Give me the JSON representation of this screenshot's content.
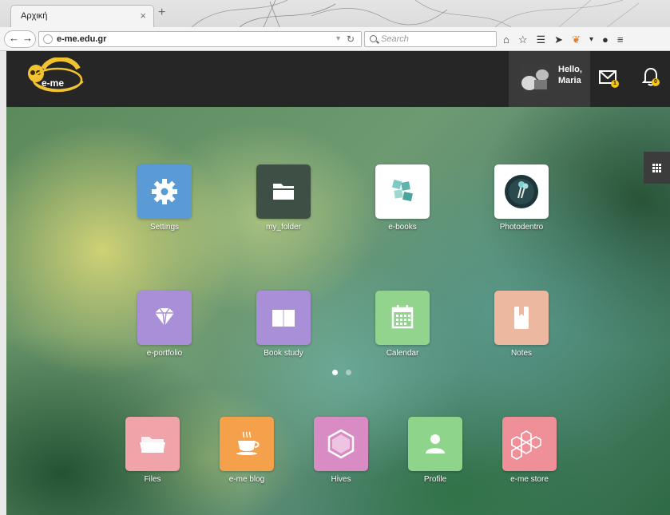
{
  "browser": {
    "tab_title": "Αρχική",
    "tab_close": "×",
    "new_tab": "+",
    "url": "e-me.edu.gr",
    "search_placeholder": "Search"
  },
  "header": {
    "greeting_line1": "Hello,",
    "greeting_line2": "Maria",
    "mail_badge": "1",
    "notif_badge": "0"
  },
  "grid_apps": [
    {
      "label": "Settings",
      "color": "#5b9bd5",
      "icon": "gear-icon"
    },
    {
      "label": "my_folder",
      "color": "#3e4f45",
      "icon": "folder-icon"
    },
    {
      "label": "e-books",
      "color": "#ffffff",
      "icon": "ebook-icon"
    },
    {
      "label": "Photodentro",
      "color": "#ffffff",
      "icon": "photodentro-icon"
    },
    {
      "label": "e-portfolio",
      "color": "#a98fd8",
      "icon": "diamond-icon"
    },
    {
      "label": "Book study",
      "color": "#a98fd8",
      "icon": "book-icon"
    },
    {
      "label": "Calendar",
      "color": "#92d48e",
      "icon": "calendar-icon"
    },
    {
      "label": "Notes",
      "color": "#ecb9a0",
      "icon": "notes-icon"
    }
  ],
  "dock_apps": [
    {
      "label": "Files",
      "color": "#f0a3a8",
      "icon": "folder-icon"
    },
    {
      "label": "e-me blog",
      "color": "#f5a04a",
      "icon": "coffee-cup-icon"
    },
    {
      "label": "Hives",
      "color": "#d98cc4",
      "icon": "hexagon-icon"
    },
    {
      "label": "Profile",
      "color": "#8fd48b",
      "icon": "person-icon"
    },
    {
      "label": "e-me store",
      "color": "#ef8f98",
      "icon": "honeycomb-icon"
    }
  ],
  "pager": {
    "pages": 2,
    "active": 1,
    "active_color": "#ffffff",
    "inactive_color": "rgba(255,255,255,0.45)"
  }
}
